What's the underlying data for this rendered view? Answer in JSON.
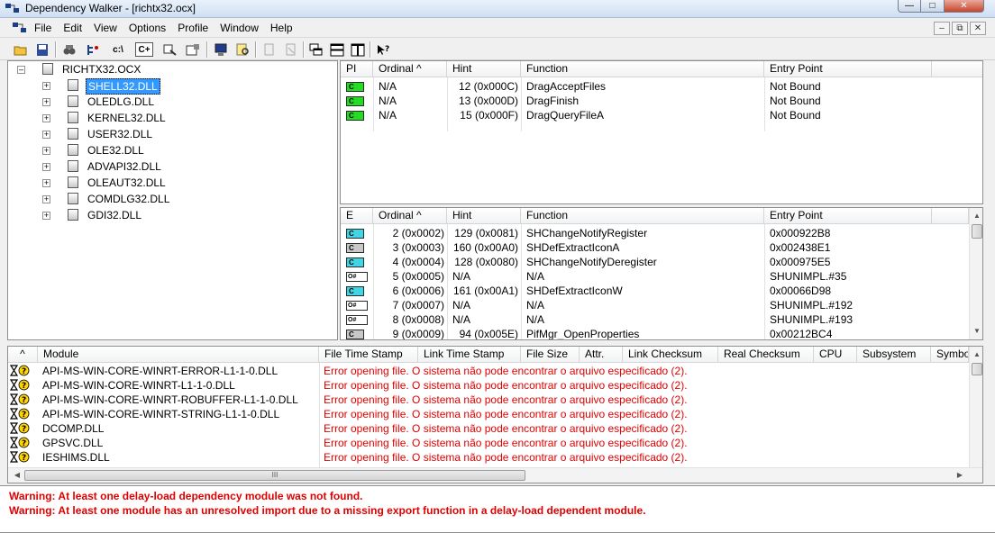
{
  "window": {
    "title": "Dependency Walker - [richtx32.ocx]",
    "minimize": "—",
    "maximize": "□",
    "close": "✕"
  },
  "menu": [
    "File",
    "Edit",
    "View",
    "Options",
    "Profile",
    "Window",
    "Help"
  ],
  "mdi_buttons": [
    "–",
    "⧉",
    "✕"
  ],
  "toolbar": {
    "cpp_label": "C+",
    "c_label": "c:\\"
  },
  "tree": {
    "root": "RICHTX32.OCX",
    "children": [
      "SHELL32.DLL",
      "OLEDLG.DLL",
      "KERNEL32.DLL",
      "USER32.DLL",
      "OLE32.DLL",
      "ADVAPI32.DLL",
      "OLEAUT32.DLL",
      "COMDLG32.DLL",
      "GDI32.DLL"
    ],
    "selected_index": 0
  },
  "imports": {
    "headers": [
      "PI",
      "Ordinal ^",
      "Hint",
      "Function",
      "Entry Point"
    ],
    "rows": [
      {
        "badge": "C",
        "ordinal": "N/A",
        "hint": "12 (0x000C)",
        "function": "DragAcceptFiles",
        "entry": "Not Bound"
      },
      {
        "badge": "C",
        "ordinal": "N/A",
        "hint": "13 (0x000D)",
        "function": "DragFinish",
        "entry": "Not Bound"
      },
      {
        "badge": "C",
        "ordinal": "N/A",
        "hint": "15 (0x000F)",
        "function": "DragQueryFileA",
        "entry": "Not Bound"
      }
    ]
  },
  "exports": {
    "headers": [
      "E",
      "Ordinal ^",
      "Hint",
      "Function",
      "Entry Point"
    ],
    "rows": [
      {
        "badge": "C",
        "kind": "cyan",
        "ordinal": "2 (0x0002)",
        "hint": "129 (0x0081)",
        "function": "SHChangeNotifyRegister",
        "entry": "0x000922B8"
      },
      {
        "badge": "C",
        "kind": "gray",
        "ordinal": "3 (0x0003)",
        "hint": "160 (0x00A0)",
        "function": "SHDefExtractIconA",
        "entry": "0x002438E1"
      },
      {
        "badge": "C",
        "kind": "cyan",
        "ordinal": "4 (0x0004)",
        "hint": "128 (0x0080)",
        "function": "SHChangeNotifyDeregister",
        "entry": "0x000975E5"
      },
      {
        "badge": "O#",
        "kind": "ord",
        "ordinal": "5 (0x0005)",
        "hint": "N/A",
        "function": "N/A",
        "entry": "SHUNIMPL.#35"
      },
      {
        "badge": "C",
        "kind": "cyan",
        "ordinal": "6 (0x0006)",
        "hint": "161 (0x00A1)",
        "function": "SHDefExtractIconW",
        "entry": "0x00066D98"
      },
      {
        "badge": "O#",
        "kind": "ord",
        "ordinal": "7 (0x0007)",
        "hint": "N/A",
        "function": "N/A",
        "entry": "SHUNIMPL.#192"
      },
      {
        "badge": "O#",
        "kind": "ord",
        "ordinal": "8 (0x0008)",
        "hint": "N/A",
        "function": "N/A",
        "entry": "SHUNIMPL.#193"
      },
      {
        "badge": "C",
        "kind": "gray",
        "ordinal": "9 (0x0009)",
        "hint": "94 (0x005E)",
        "function": "PifMgr_OpenProperties",
        "entry": "0x00212BC4"
      }
    ]
  },
  "modules": {
    "headers": [
      "^",
      "Module",
      "File Time Stamp",
      "Link Time Stamp",
      "File Size",
      "Attr.",
      "Link Checksum",
      "Real Checksum",
      "CPU",
      "Subsystem",
      "Symbo"
    ],
    "rows": [
      {
        "name": "API-MS-WIN-CORE-WINRT-ERROR-L1-1-0.DLL",
        "error": "Error opening file. O sistema não pode encontrar o arquivo especificado (2)."
      },
      {
        "name": "API-MS-WIN-CORE-WINRT-L1-1-0.DLL",
        "error": "Error opening file. O sistema não pode encontrar o arquivo especificado (2)."
      },
      {
        "name": "API-MS-WIN-CORE-WINRT-ROBUFFER-L1-1-0.DLL",
        "error": "Error opening file. O sistema não pode encontrar o arquivo especificado (2)."
      },
      {
        "name": "API-MS-WIN-CORE-WINRT-STRING-L1-1-0.DLL",
        "error": "Error opening file. O sistema não pode encontrar o arquivo especificado (2)."
      },
      {
        "name": "DCOMP.DLL",
        "error": "Error opening file. O sistema não pode encontrar o arquivo especificado (2)."
      },
      {
        "name": "GPSVC.DLL",
        "error": "Error opening file. O sistema não pode encontrar o arquivo especificado (2)."
      },
      {
        "name": "IESHIMS.DLL",
        "error": "Error opening file. O sistema não pode encontrar o arquivo especificado (2)."
      }
    ],
    "hscroll_grip": "III"
  },
  "log": [
    "Warning: At least one delay-load dependency module was not found.",
    "Warning: At least one module has an unresolved import due to a missing export function in a delay-load dependent module."
  ],
  "colors": {
    "error_red": "#e00000",
    "selection_blue": "#3399ff",
    "bound_green": "#22dd22",
    "export_cyan": "#3fd7e6"
  }
}
